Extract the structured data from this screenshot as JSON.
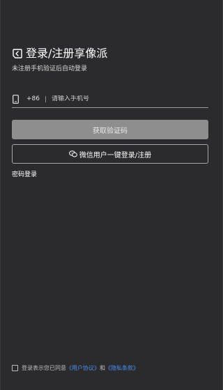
{
  "header": {
    "title": "登录/注册享像派",
    "subtitle": "未注册手机验证后自动登录"
  },
  "phone": {
    "country_code": "+86",
    "placeholder": "请输入手机号",
    "value": ""
  },
  "buttons": {
    "get_code": "获取验证码",
    "wechat": "微信用户一键登录/注册"
  },
  "password_login": "密码登录",
  "agreement": {
    "prefix": "登录表示您已同意",
    "user_agreement": "《用户协议》",
    "and": "和",
    "privacy_policy": "《隐私条款》",
    "checked": false
  },
  "colors": {
    "background": "#2b2b2d",
    "disabled_button": "#8e8e8e",
    "link": "#4a8ff0"
  },
  "icons": {
    "logo": "login-logo-icon",
    "phone": "phone-icon",
    "wechat": "wechat-icon"
  }
}
